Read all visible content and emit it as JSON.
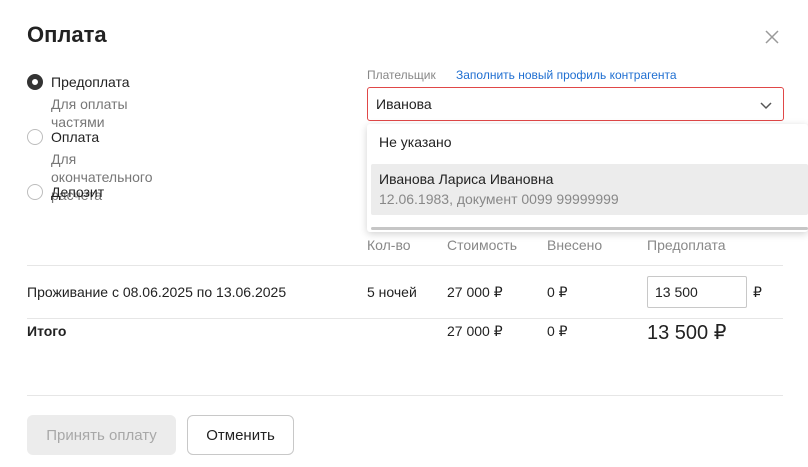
{
  "dialog": {
    "title": "Оплата"
  },
  "payment_types": [
    {
      "label": "Предоплата",
      "sub": "Для оплаты частями",
      "checked": true
    },
    {
      "label": "Оплата",
      "sub": "Для окончательного расчета",
      "checked": false
    },
    {
      "label": "Депозит",
      "sub": "",
      "checked": false
    }
  ],
  "payer": {
    "label": "Плательщик",
    "link": "Заполнить новый профиль контрагента",
    "selected": "Иванова",
    "options": [
      {
        "name": "Не указано"
      },
      {
        "name": "Иванова Лариса Ивановна",
        "details": "12.06.1983, документ 0099 99999999",
        "highlighted": true
      }
    ]
  },
  "table": {
    "headers": {
      "qty": "Кол-во",
      "cost": "Стоимость",
      "paid": "Внесено",
      "prepay": "Предоплата"
    },
    "row": {
      "name": "Проживание с 08.06.2025 по 13.06.2025",
      "qty": "5 ночей",
      "cost": "27 000 ₽",
      "paid": "0 ₽",
      "prepay_value": "13 500",
      "currency": "₽"
    },
    "total": {
      "label": "Итого",
      "cost": "27 000 ₽",
      "paid": "0 ₽",
      "prepay": "13 500 ₽"
    }
  },
  "buttons": {
    "accept": "Принять оплату",
    "cancel": "Отменить"
  },
  "colors": {
    "error_border": "#e04848",
    "link": "#1f6fd1"
  }
}
